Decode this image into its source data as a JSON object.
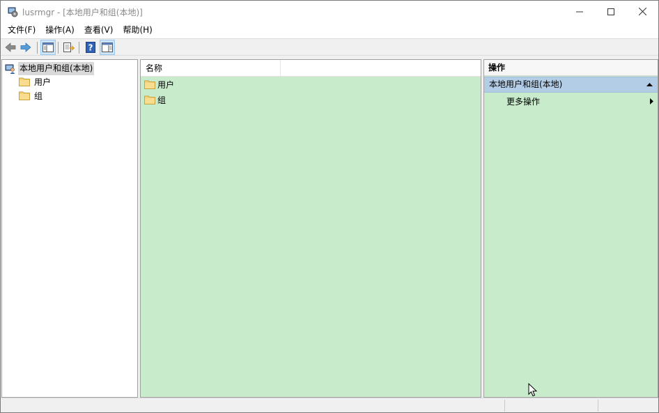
{
  "window": {
    "title": "lusrmgr - [本地用户和组(本地)]"
  },
  "menu": {
    "items": [
      "文件(F)",
      "操作(A)",
      "查看(V)",
      "帮助(H)"
    ]
  },
  "tree": {
    "root": "本地用户和组(本地)",
    "children": [
      "用户",
      "组"
    ]
  },
  "list": {
    "column_name": "名称",
    "rows": [
      "用户",
      "组"
    ]
  },
  "actions": {
    "title": "操作",
    "section": "本地用户和组(本地)",
    "more": "更多操作"
  },
  "colors": {
    "pane_background": "#c7ebcb",
    "action_section": "#b4cde6",
    "folder": "#f5d27a"
  }
}
